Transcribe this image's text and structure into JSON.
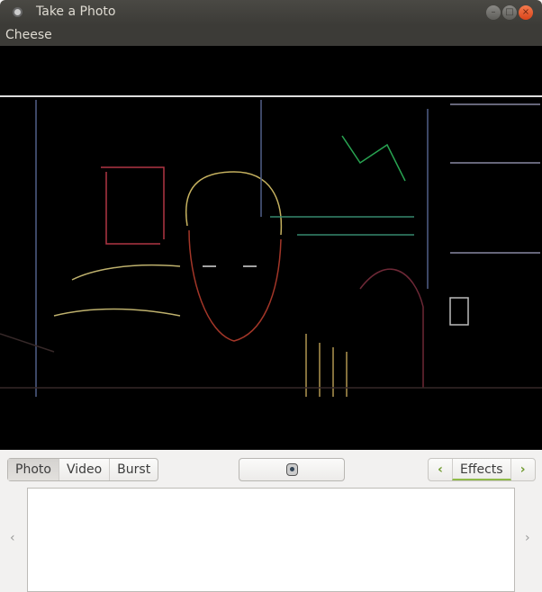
{
  "window": {
    "title": "Take a Photo",
    "minimize": "–",
    "maximize": "□",
    "close": "×"
  },
  "menu": {
    "app": "Cheese"
  },
  "modes": [
    {
      "label": "Photo",
      "active": true
    },
    {
      "label": "Video"
    },
    {
      "label": "Burst"
    }
  ],
  "effects": {
    "label": "Effects",
    "prev": "‹",
    "next": "›"
  },
  "thumbnails": {
    "prev": "‹",
    "next": "›"
  }
}
